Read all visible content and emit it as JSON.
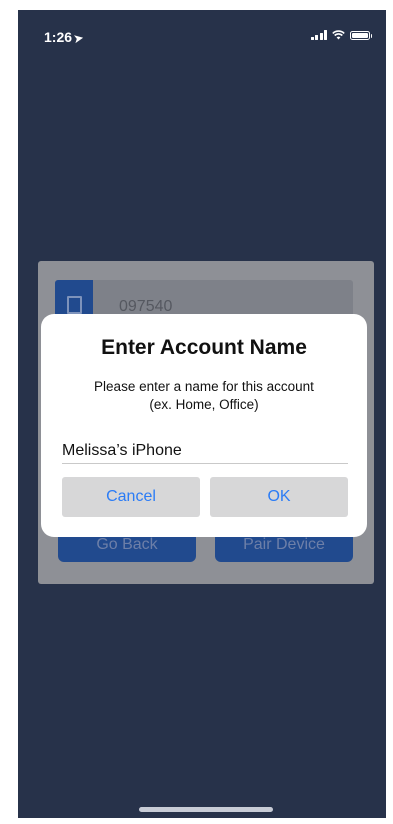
{
  "status_bar": {
    "time": "1:26",
    "location_arrow": "➤",
    "icons": [
      "signal-icon",
      "wifi-icon",
      "battery-icon"
    ]
  },
  "background_card": {
    "account_code": "097540",
    "go_back_label": "Go Back",
    "pair_device_label": "Pair Device"
  },
  "dialog": {
    "title": "Enter Account Name",
    "message_line1": "Please enter a name for this account",
    "message_line2": "(ex. Home, Office)",
    "input_value": "Melissa’s iPhone",
    "cancel_label": "Cancel",
    "ok_label": "OK"
  },
  "colors": {
    "screen_background": "#27324a",
    "primary_blue": "#214a8e",
    "dialog_button_text": "#2b7cf6"
  }
}
